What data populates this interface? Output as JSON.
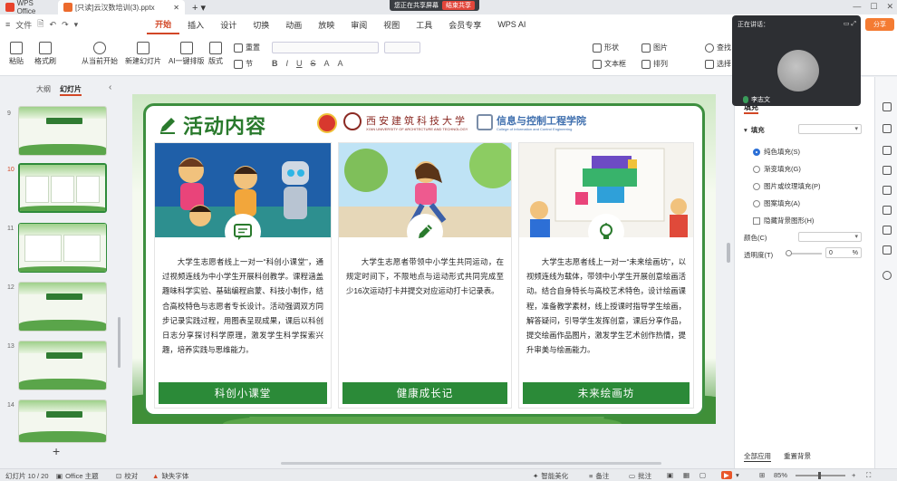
{
  "titlebar": {
    "home_tab": "WPS Office",
    "doc_tab": "[只读]云汉数培训(3).pptx",
    "share_status": "您正在共享屏幕",
    "share_end": "结束共享"
  },
  "menu": {
    "file": "文件",
    "items": [
      "开始",
      "插入",
      "设计",
      "切换",
      "动画",
      "放映",
      "审阅",
      "视图",
      "工具",
      "会员专享",
      "WPS AI"
    ],
    "active": "开始"
  },
  "ribbon": {
    "new_slide": "新建幻灯片",
    "layout": "版式",
    "ai_layout": "AI一键排版",
    "reset": "重置",
    "section": "节",
    "shape": "形状",
    "picture": "图片",
    "textbox": "文本框",
    "arrange": "排列",
    "find": "查找",
    "select": "选择",
    "paste": "粘贴",
    "format_painter": "格式刷",
    "play": "从当前开始",
    "bold": "B",
    "italic": "I",
    "underline": "U",
    "strike": "S"
  },
  "leftpanel": {
    "tab_outline": "大纲",
    "tab_slides": "幻灯片",
    "slide_numbers": [
      "9",
      "10",
      "11",
      "12",
      "13",
      "14"
    ],
    "add": "+"
  },
  "slide": {
    "title": "活动内容",
    "univ_name": "西安建筑科技大学",
    "univ_en": "XI'AN UNIVERSITY OF ARCHITECTURE AND TECHNOLOGY",
    "college_name": "信息与控制工程学院",
    "college_en": "College of Information and Control Engineering",
    "cards": [
      {
        "text": "大学生志愿者线上一对一“科创小课堂”，通过视频连线为中小学生开展科创教学。课程涵盖趣味科学实验、基础编程启蒙、科技小制作，结合高校特色与志愿者专长设计。活动强调双方同步记录实践过程，用图表呈现成果，课后以科创日志分享探讨科学原理，激发学生科学探索兴趣，培养实践与思维能力。",
        "footer": "科创小课堂",
        "icon": "chat-icon"
      },
      {
        "text": "大学生志愿者带领中小学生共同运动，在规定时间下，不限地点与运动形式共同完成至少16次运动打卡并提交对应运动打卡记录表。",
        "footer": "健康成长记",
        "icon": "pencil-icon"
      },
      {
        "text": "大学生志愿者线上一对一“未来绘画坊”，以视频连线为载体，带领中小学生开展创意绘画活动。结合自身特长与高校艺术特色，设计绘画课程，准备教学素材，线上授课时指导学生绘画，解答疑问，引导学生发挥创意，课后分享作品，提交绘画作品图片，激发学生艺术创作热情，提升审美与绘画能力。",
        "footer": "未来绘画坊",
        "icon": "lightbulb-icon"
      }
    ]
  },
  "rightpanel": {
    "tab": "填充",
    "section": "填充",
    "options": [
      "纯色填充(S)",
      "渐变填充(G)",
      "图片或纹理填充(P)",
      "图案填充(A)"
    ],
    "selected_option": "纯色填充(S)",
    "hide_bg": "隐藏背景图形(H)",
    "color_label": "颜色(C)",
    "transparency_label": "透明度(T)",
    "transparency_value": "0",
    "transparency_unit": "%",
    "apply_all": "全部应用",
    "reset_bg": "重置背景"
  },
  "speaker": {
    "label": "正在讲话：",
    "name": "李志文"
  },
  "share_button": "分享",
  "statusbar": {
    "slide_pos": "幻灯片 10 / 20",
    "theme": "Office 主题",
    "proof": "校对",
    "missing_font": "缺失字体",
    "smart_beautify": "智能美化",
    "notes": "备注",
    "comments": "批注",
    "zoom": "85%"
  },
  "colors": {
    "accent": "#d24726",
    "green": "#2b8a38",
    "dark_green": "#2a7a2d"
  }
}
